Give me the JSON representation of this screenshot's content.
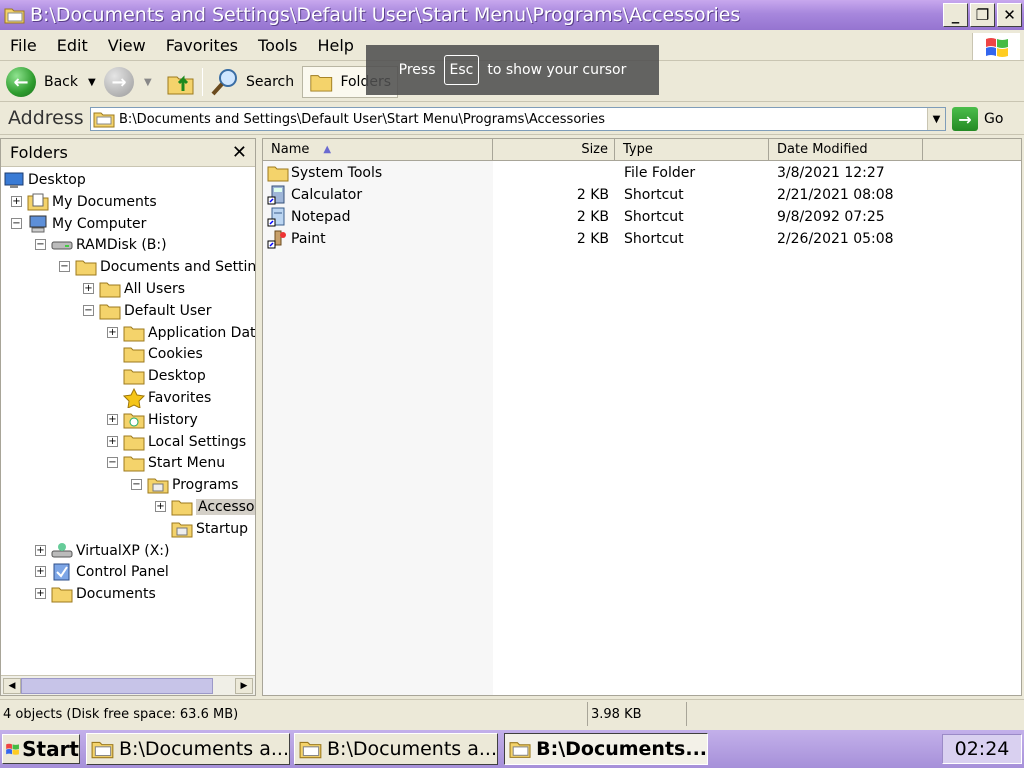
{
  "window": {
    "title": "B:\\Documents and Settings\\Default User\\Start Menu\\Programs\\Accessories",
    "buttons": {
      "minimize": "_",
      "maximize": "❐",
      "close": "✕"
    }
  },
  "menu": [
    "File",
    "Edit",
    "View",
    "Favorites",
    "Tools",
    "Help"
  ],
  "toolbar": {
    "back": "Back",
    "search": "Search",
    "folders": "Folders"
  },
  "overlay": {
    "press": "Press",
    "key": "Esc",
    "rest": "to show your cursor"
  },
  "address": {
    "label": "Address",
    "value": "B:\\Documents and Settings\\Default User\\Start Menu\\Programs\\Accessories",
    "go": "Go"
  },
  "folders_pane": {
    "title": "Folders",
    "tree": [
      {
        "label": "Desktop",
        "depth": 0,
        "expander": "",
        "icon": "desktop"
      },
      {
        "label": "My Documents",
        "depth": 1,
        "expander": "+",
        "icon": "documents"
      },
      {
        "label": "My Computer",
        "depth": 1,
        "expander": "−",
        "icon": "computer"
      },
      {
        "label": "RAMDisk (B:)",
        "depth": 2,
        "expander": "−",
        "icon": "drive"
      },
      {
        "label": "Documents and Settings",
        "depth": 3,
        "expander": "−",
        "icon": "folder"
      },
      {
        "label": "All Users",
        "depth": 4,
        "expander": "+",
        "icon": "folder"
      },
      {
        "label": "Default User",
        "depth": 4,
        "expander": "−",
        "icon": "folder"
      },
      {
        "label": "Application Data",
        "depth": 5,
        "expander": "+",
        "icon": "folder"
      },
      {
        "label": "Cookies",
        "depth": 5,
        "expander": "",
        "icon": "folder"
      },
      {
        "label": "Desktop",
        "depth": 5,
        "expander": "",
        "icon": "folder"
      },
      {
        "label": "Favorites",
        "depth": 5,
        "expander": "",
        "icon": "star"
      },
      {
        "label": "History",
        "depth": 5,
        "expander": "+",
        "icon": "history"
      },
      {
        "label": "Local Settings",
        "depth": 5,
        "expander": "+",
        "icon": "folder"
      },
      {
        "label": "Start Menu",
        "depth": 5,
        "expander": "−",
        "icon": "folder"
      },
      {
        "label": "Programs",
        "depth": 6,
        "expander": "−",
        "icon": "programs"
      },
      {
        "label": "Accessories",
        "depth": 7,
        "expander": "+",
        "icon": "folder",
        "selected": true
      },
      {
        "label": "Startup",
        "depth": 7,
        "expander": "",
        "icon": "programs"
      },
      {
        "label": "VirtualXP (X:)",
        "depth": 2,
        "expander": "+",
        "icon": "netdrive"
      },
      {
        "label": "Control Panel",
        "depth": 2,
        "expander": "+",
        "icon": "control"
      },
      {
        "label": "Documents",
        "depth": 2,
        "expander": "+",
        "icon": "folder"
      }
    ]
  },
  "columns": {
    "name": "Name",
    "size": "Size",
    "type": "Type",
    "date": "Date Modified"
  },
  "files": [
    {
      "name": "System Tools",
      "size": "",
      "type": "File Folder",
      "date": "3/8/2021 12:27",
      "icon": "folder"
    },
    {
      "name": "Calculator",
      "size": "2 KB",
      "type": "Shortcut",
      "date": "2/21/2021 08:08",
      "icon": "calculator"
    },
    {
      "name": "Notepad",
      "size": "2 KB",
      "type": "Shortcut",
      "date": "9/8/2092 07:25",
      "icon": "notepad"
    },
    {
      "name": "Paint",
      "size": "2 KB",
      "type": "Shortcut",
      "date": "2/26/2021 05:08",
      "icon": "paint"
    }
  ],
  "status": {
    "objects": "4 objects (Disk free space: 63.6 MB)",
    "size": "3.98 KB"
  },
  "taskbar": {
    "start": "Start",
    "tasks": [
      "B:\\Documents a...",
      "B:\\Documents a...",
      "B:\\Documents..."
    ],
    "clock": "02:24"
  },
  "colors": {
    "titlebar": "#a787dd",
    "taskbar": "#a690d9",
    "folder": "#f4d36b"
  }
}
